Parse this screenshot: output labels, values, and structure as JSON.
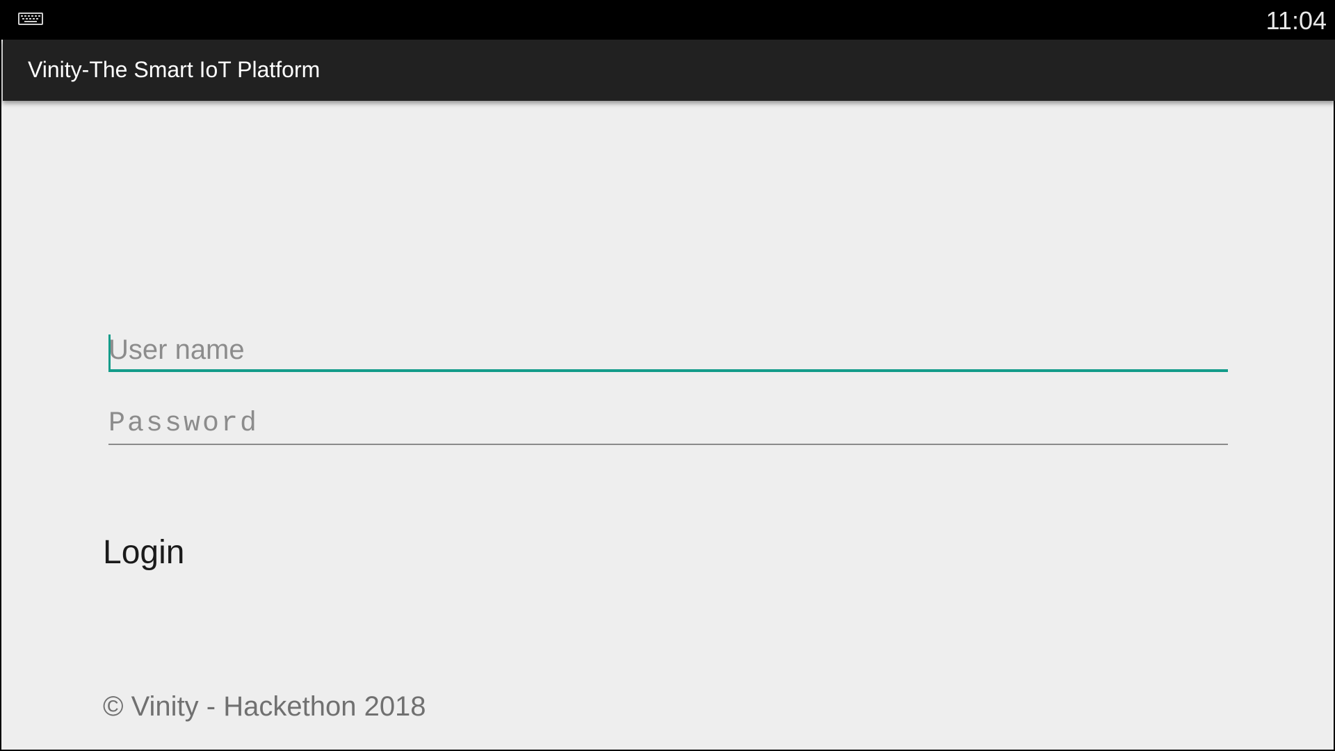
{
  "status_bar": {
    "left_icon": "keyboard-icon",
    "time": "11:04"
  },
  "action_bar": {
    "title": "Vinity-The Smart IoT Platform"
  },
  "form": {
    "username": {
      "value": "",
      "placeholder": "User name",
      "focused": true
    },
    "password": {
      "value": "",
      "placeholder": "Password"
    },
    "login_label": "Login"
  },
  "footer": {
    "text": "© Vinity - Hackethon 2018"
  },
  "colors": {
    "accent": "#139c8a",
    "action_bar": "#212121",
    "background": "#eeeeee",
    "status_bar": "#000000"
  }
}
